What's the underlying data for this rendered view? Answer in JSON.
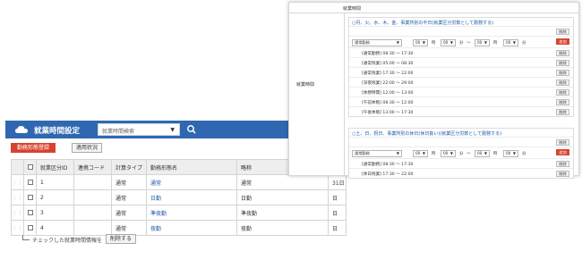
{
  "list": {
    "title": "就業時間設定",
    "search": {
      "placeholder": "就業時間検索"
    },
    "buttons": {
      "register": "勤務形態登録",
      "apply": "適用状況",
      "delete": "削除する"
    },
    "columns": [
      "",
      "",
      "就業区分ID",
      "連携コード",
      "計算タイプ",
      "勤務形態名",
      "略称",
      ""
    ],
    "rows": [
      {
        "id": "1",
        "code": "",
        "calc": "通常",
        "name": "通常",
        "abbr": "通常",
        "extra": "31日"
      },
      {
        "id": "2",
        "code": "",
        "calc": "通常",
        "name": "日勤",
        "abbr": "日勤",
        "extra": "日"
      },
      {
        "id": "3",
        "code": "",
        "calc": "通常",
        "name": "準夜勤",
        "abbr": "準夜勤",
        "extra": "日"
      },
      {
        "id": "4",
        "code": "",
        "calc": "通常",
        "name": "夜勤",
        "abbr": "夜勤",
        "extra": "日"
      }
    ],
    "footer_note": "チェックした就業時間情報を"
  },
  "detail": {
    "header": "就業時間",
    "side_label": "就業時間",
    "weekday": {
      "heading": "○月、火、水、木、金、事業所別の平日(就業区分労数として勤務する)",
      "select_label": "通常勤務",
      "select_values": [
        "00",
        "00",
        "00",
        "00"
      ],
      "sep_labels": [
        "時",
        "分",
        "〜",
        "時",
        "分"
      ],
      "rows": [
        {
          "label": "[通常勤務]  08:30 〜 17:30"
        },
        {
          "label": "[通常残業]  05:00 〜 08:30"
        },
        {
          "label": "[通常残業]  17:30 〜 22:00"
        },
        {
          "label": "[深夜残業]  22:00 〜 29:00"
        },
        {
          "label": "[休憩時間]  12:00 〜 13:00"
        },
        {
          "label": "[午前休暇]  08:30 〜 12:00"
        },
        {
          "label": "[午後休暇]  13:00 〜 17:30"
        }
      ]
    },
    "holiday": {
      "heading": "○土、日、祝日、事業所別の休日(休日扱い)(就業区分労数として勤務する)",
      "select_label": "通常勤務",
      "select_values": [
        "00",
        "00",
        "00",
        "00"
      ],
      "rows": [
        {
          "label": "[通常勤務]  08:30 〜 17:30"
        },
        {
          "label": "[休日残業]  17:30 〜 22:00"
        }
      ]
    },
    "btn_delete": "削除",
    "btn_add": "追加"
  },
  "colors": {
    "header_blue": "#2f68b0",
    "accent_red": "#d8432f",
    "link_blue": "#1a5aa8"
  }
}
